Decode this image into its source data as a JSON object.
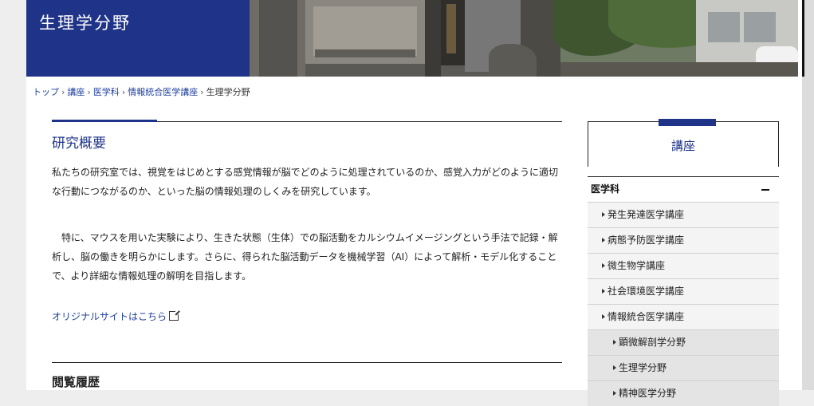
{
  "header": {
    "title": "生理学分野"
  },
  "breadcrumb": {
    "items": [
      "トップ",
      "講座",
      "医学科",
      "情報統合医学講座"
    ],
    "current": "生理学分野"
  },
  "main": {
    "section_title": "研究概要",
    "paragraph1": "私たちの研究室では、視覚をはじめとする感覚情報が脳でどのように処理されているのか、感覚入力がどのように適切な行動につながるのか、といった脳の情報処理のしくみを研究しています。",
    "paragraph2": "特に、マウスを用いた実験により、生きた状態（生体）での脳活動をカルシウムイメージングという手法で記録・解析し、脳の働きを明らかにします。さらに、得られた脳活動データを機械学習（AI）によって解析・モデル化することで、より詳細な情報処理の解明を目指します。",
    "original_site_link": "オリジナルサイトはこちら",
    "history_title": "閲覧履歴"
  },
  "sidebar": {
    "heading": "講座",
    "category": "医学科",
    "items": [
      "発生発達医学講座",
      "病態予防医学講座",
      "微生物学講座",
      "社会環境医学講座",
      "情報統合医学講座"
    ],
    "sub_items": [
      "顕微解剖学分野",
      "生理学分野",
      "精神医学分野"
    ]
  },
  "colors": {
    "brand_navy": "#1f3388",
    "link_blue": "#1f3f9e"
  },
  "icons": {
    "external_link": "external-link-icon",
    "collapse": "minus-icon",
    "bullet": "triangle-right-icon"
  }
}
